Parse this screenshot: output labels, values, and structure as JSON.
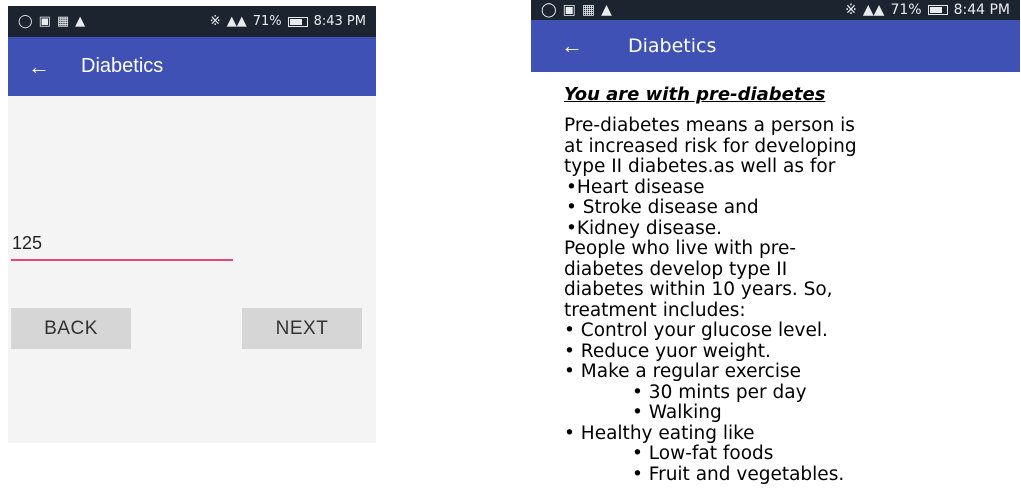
{
  "left_screen": {
    "status": {
      "time": "8:43 PM",
      "battery": "71%",
      "signal": "⁵ᴳ▗▗ ⁵ᴳ▗▗"
    },
    "appbar": {
      "title": "Diabetics"
    },
    "input": {
      "value": "125"
    },
    "buttons": {
      "back": "BACK",
      "next": "NEXT"
    }
  },
  "right_screen": {
    "status": {
      "time": "8:44 PM",
      "battery": "71%",
      "signal": "⁵ᴳ▗▗ ⁵ᴳ▗▗"
    },
    "appbar": {
      "title": "Diabetics"
    },
    "heading": "You are with pre-diabetes",
    "intro": "Pre-diabetes means a person is\nat increased risk for developing\ntype II diabetes.as well as for",
    "risk_items": [
      "•Heart disease",
      "• Stroke disease and",
      "•Kidney disease."
    ],
    "people_text": " People who live with pre-\ndiabetes develop type II\ndiabetes within 10 years. So,\ntreatment includes:",
    "treatment_items": [
      "•  Control your glucose level.",
      "•  Reduce yuor weight.",
      "•  Make a regular exercise"
    ],
    "exercise_items": [
      "•   30 mints per day",
      "•   Walking"
    ],
    "healthy_label": "• Healthy eating like",
    "food_items": [
      "•   Low-fat foods",
      "•   Fruit and vegetables."
    ]
  }
}
